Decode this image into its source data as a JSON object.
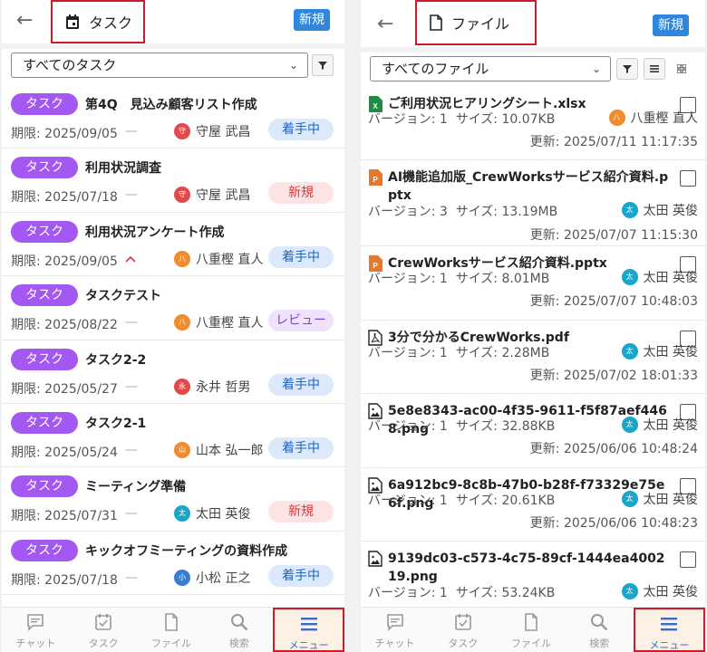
{
  "left": {
    "title": "タスク",
    "new_label": "新規",
    "filter_value": "すべてのタスク",
    "tag_label": "タスク",
    "due_prefix": "期限: ",
    "tasks": [
      {
        "title": "第4Q　見込み顧客リスト作成",
        "due": "2025/09/05",
        "priority": "—",
        "owner": "守屋 武昌",
        "avatar": "守",
        "avatar_color": "#e24a4a",
        "status": "着手中",
        "status_style": "blue"
      },
      {
        "title": "利用状況調査",
        "due": "2025/07/18",
        "priority": "—",
        "owner": "守屋 武昌",
        "avatar": "守",
        "avatar_color": "#e24a4a",
        "status": "新規",
        "status_style": "red"
      },
      {
        "title": "利用状況アンケート作成",
        "due": "2025/09/05",
        "priority": "^",
        "owner": "八重樫 直人",
        "avatar": "八",
        "avatar_color": "#f28a2e",
        "status": "着手中",
        "status_style": "blue"
      },
      {
        "title": "タスクテスト",
        "due": "2025/08/22",
        "priority": "—",
        "owner": "八重樫 直人",
        "avatar": "八",
        "avatar_color": "#f28a2e",
        "status": "レビュー",
        "status_style": "purple"
      },
      {
        "title": "タスク2-2",
        "due": "2025/05/27",
        "priority": "—",
        "owner": "永井 哲男",
        "avatar": "永",
        "avatar_color": "#e24a4a",
        "status": "着手中",
        "status_style": "blue"
      },
      {
        "title": "タスク2-1",
        "due": "2025/05/24",
        "priority": "—",
        "owner": "山本 弘一郎",
        "avatar": "山",
        "avatar_color": "#f28a2e",
        "status": "着手中",
        "status_style": "blue"
      },
      {
        "title": "ミーティング準備",
        "due": "2025/07/31",
        "priority": "—",
        "owner": "太田 英俊",
        "avatar": "太",
        "avatar_color": "#1aa6c8",
        "status": "新規",
        "status_style": "red"
      },
      {
        "title": "キックオフミーティングの資料作成",
        "due": "2025/07/18",
        "priority": "—",
        "owner": "小松 正之",
        "avatar": "小",
        "avatar_color": "#3a7bd5",
        "status": "着手中",
        "status_style": "blue"
      }
    ]
  },
  "right": {
    "title": "ファイル",
    "new_label": "新規",
    "filter_value": "すべてのファイル",
    "version_prefix": "バージョン: ",
    "size_prefix": "サイズ: ",
    "updated_prefix": "更新: ",
    "files": [
      {
        "name": "ご利用状況ヒアリングシート.xlsx",
        "type": "xlsx",
        "version": "1",
        "size": "10.07KB",
        "owner": "八重樫 直人",
        "avatar": "八",
        "avatar_color": "#f28a2e",
        "updated": "2025/07/11 11:17:35"
      },
      {
        "name": "AI機能追加版_CrewWorksサービス紹介資料.pptx",
        "type": "pptx",
        "version": "3",
        "size": "13.19MB",
        "owner": "太田 英俊",
        "avatar": "太",
        "avatar_color": "#1aa6c8",
        "updated": "2025/07/07 11:15:30"
      },
      {
        "name": "CrewWorksサービス紹介資料.pptx",
        "type": "pptx",
        "version": "1",
        "size": "8.01MB",
        "owner": "太田 英俊",
        "avatar": "太",
        "avatar_color": "#1aa6c8",
        "updated": "2025/07/07 10:48:03"
      },
      {
        "name": "3分で分かるCrewWorks.pdf",
        "type": "pdf",
        "version": "1",
        "size": "2.28MB",
        "owner": "太田 英俊",
        "avatar": "太",
        "avatar_color": "#1aa6c8",
        "updated": "2025/07/02 18:01:33"
      },
      {
        "name": "5e8e8343-ac00-4f35-9611-f5f87aef4468.png",
        "type": "png",
        "version": "1",
        "size": "32.88KB",
        "owner": "太田 英俊",
        "avatar": "太",
        "avatar_color": "#1aa6c8",
        "updated": "2025/06/06 10:48:24"
      },
      {
        "name": "6a912bc9-8c8b-47b0-b28f-f73329e75e6f.png",
        "type": "png",
        "version": "1",
        "size": "20.61KB",
        "owner": "太田 英俊",
        "avatar": "太",
        "avatar_color": "#1aa6c8",
        "updated": "2025/06/06 10:48:23"
      },
      {
        "name": "9139dc03-c573-4c75-89cf-1444ea400219.png",
        "type": "png",
        "version": "1",
        "size": "53.24KB",
        "owner": "太田 英俊",
        "avatar": "太",
        "avatar_color": "#1aa6c8",
        "updated": ""
      }
    ]
  },
  "nav": [
    {
      "label": "チャット",
      "icon": "chat-icon"
    },
    {
      "label": "タスク",
      "icon": "task-icon"
    },
    {
      "label": "ファイル",
      "icon": "file-icon"
    },
    {
      "label": "検索",
      "icon": "search-icon"
    },
    {
      "label": "メニュー",
      "icon": "menu-icon",
      "active": true
    }
  ]
}
